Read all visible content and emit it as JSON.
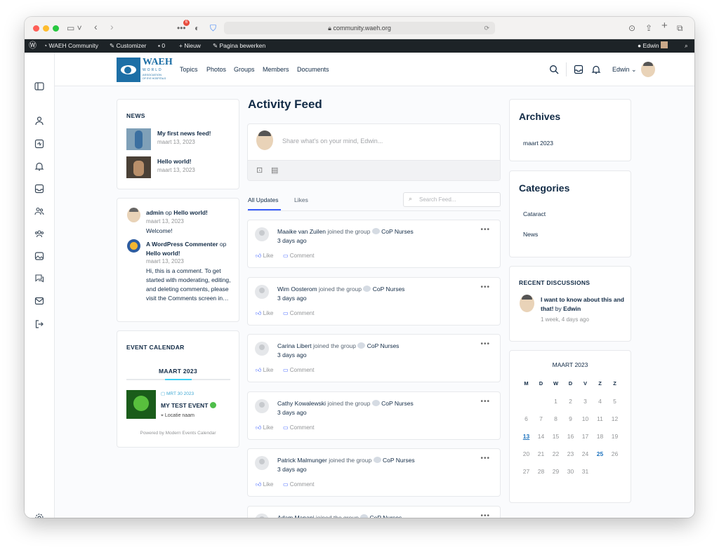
{
  "browser": {
    "url": "community.waeh.org",
    "badge": "6"
  },
  "wpbar": {
    "site": "WAEH Community",
    "customizer": "Customizer",
    "comments": "0",
    "new": "Nieuw",
    "edit": "Pagina bewerken",
    "user": "Edwin"
  },
  "logo": {
    "big": "WAEH",
    "l1": "WORLD",
    "l2": "ASSOCIATION",
    "l3": "OF EYE HOSPITALS"
  },
  "nav": [
    "Topics",
    "Photos",
    "Groups",
    "Members",
    "Documents"
  ],
  "header_user": "Edwin",
  "news": {
    "title": "NEWS",
    "items": [
      {
        "title": "My first news feed!",
        "date": "maart 13, 2023"
      },
      {
        "title": "Hello world!",
        "date": "maart 13, 2023"
      }
    ]
  },
  "comments": {
    "items": [
      {
        "author": "admin",
        "on": "op",
        "post": "Hello world!",
        "date": "maart 13, 2023",
        "text": "Welcome!"
      },
      {
        "author": "A WordPress Commenter",
        "on": "op",
        "post": "Hello world!",
        "date": "maart 13, 2023",
        "text": "Hi, this is a comment. To get started with moderating, editing, and deleting comments, please visit the Comments screen in…"
      }
    ]
  },
  "event": {
    "title": "EVENT CALENDAR",
    "month": "MAART 2023",
    "date": "MRT 30 2023",
    "name": "MY TEST EVENT",
    "location": "Locatie naam",
    "powered": "Powered by Modern Events Calendar"
  },
  "feed": {
    "title": "Activity Feed",
    "placeholder": "Share what's on your mind, Edwin...",
    "tab_all": "All Updates",
    "tab_likes": "Likes",
    "search_placeholder": "Search Feed...",
    "like": "Like",
    "comment": "Comment",
    "items": [
      {
        "user": "Maaike van Zuilen",
        "action": "joined the group",
        "group": "CoP Nurses",
        "time": "3 days ago"
      },
      {
        "user": "Wim Oosterom",
        "action": "joined the group",
        "group": "CoP Nurses",
        "time": "3 days ago"
      },
      {
        "user": "Carina Libert",
        "action": "joined the group",
        "group": "CoP Nurses",
        "time": "3 days ago"
      },
      {
        "user": "Cathy Kowalewski",
        "action": "joined the group",
        "group": "CoP Nurses",
        "time": "3 days ago"
      },
      {
        "user": "Patrick Malmunger",
        "action": "joined the group",
        "group": "CoP Nurses",
        "time": "3 days ago"
      },
      {
        "user": "Adam Manani",
        "action": "joined the group",
        "group": "CoP Nurses",
        "time": ""
      }
    ]
  },
  "archives": {
    "title": "Archives",
    "items": [
      "maart 2023"
    ]
  },
  "categories": {
    "title": "Categories",
    "items": [
      "Cataract",
      "News"
    ]
  },
  "discussions": {
    "title": "RECENT DISCUSSIONS",
    "topic": "I want to know about this and that!",
    "by": "by",
    "author": "Edwin",
    "time": "1 week, 4 days ago"
  },
  "calendar": {
    "title": "MAART 2023",
    "days": [
      "M",
      "D",
      "W",
      "D",
      "V",
      "Z",
      "Z"
    ],
    "weeks": [
      [
        "",
        "",
        "1",
        "2",
        "3",
        "4",
        "5"
      ],
      [
        "6",
        "7",
        "8",
        "9",
        "10",
        "11",
        "12"
      ],
      [
        "13",
        "14",
        "15",
        "16",
        "17",
        "18",
        "19"
      ],
      [
        "20",
        "21",
        "22",
        "23",
        "24",
        "25",
        "26"
      ],
      [
        "27",
        "28",
        "29",
        "30",
        "31",
        "",
        ""
      ]
    ],
    "today": "13",
    "event_day": "25"
  },
  "colors": {
    "accent": "#385dff",
    "link": "#1e73be",
    "dark": "#122b46",
    "muted": "#939597",
    "wpbar": "#1d2327",
    "green": "#4fbe4a"
  }
}
